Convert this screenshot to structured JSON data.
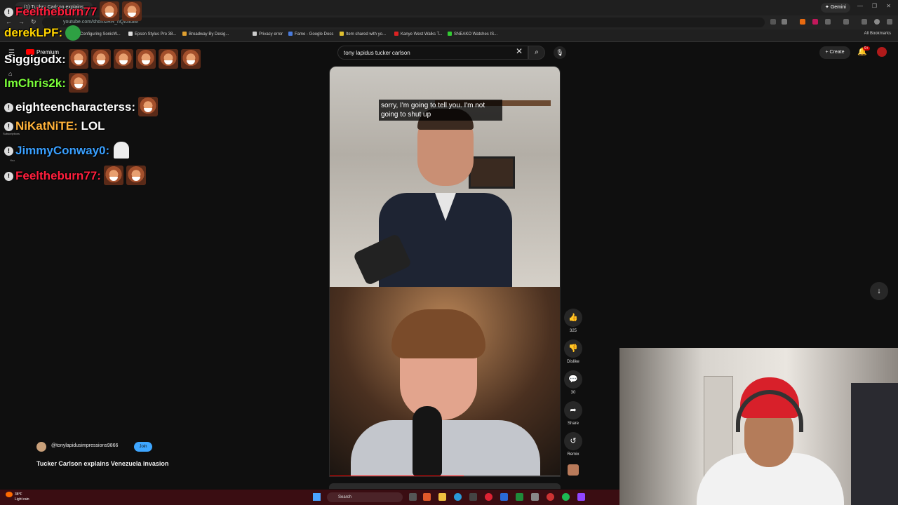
{
  "browser": {
    "tab_title": "(1) Tucker Carlson explains...",
    "gemini_label": "Gemini",
    "url": "youtube.com/shorts/RR_nQtGtdlM",
    "bookmarks": [
      "Configuring SonicW...",
      "Epson Stylus Pro 38...",
      "Broadway By Desig...",
      "Privacy error",
      "Fame - Google Docs",
      "Item shared with yo...",
      "Kanye West Walks T...",
      "SNEAKO Watches IS..."
    ],
    "all_bookmarks": "All Bookmarks"
  },
  "youtube": {
    "premium_label": "Premium",
    "search_value": "tony lapidus tucker carlson",
    "create_label": "Create",
    "notif_badge": "9+",
    "subscriptions_label": "Subscriptions",
    "you_label": "You"
  },
  "chat": [
    {
      "user": "Feeltheburn77",
      "color": "#ff1f3d",
      "msg": "",
      "emotes": 2
    },
    {
      "user": "derekLPF",
      "color": "#ffd400",
      "msg": "",
      "emotes": 0
    },
    {
      "user": "Siggigodx",
      "color": "#ffffff",
      "msg": "",
      "emotes": 6
    },
    {
      "user": "ImChris2k",
      "color": "#7cff3a",
      "msg": "",
      "emotes": 1
    },
    {
      "user": "eighteencharacterss",
      "color": "#ffffff",
      "msg": "",
      "emotes": 1
    },
    {
      "user": "NiKatNiTE",
      "color": "#ffb23a",
      "msg": "LOL",
      "emotes": 0
    },
    {
      "user": "JimmyConway0",
      "color": "#3aa0ff",
      "msg": "",
      "emotes": 0
    },
    {
      "user": "Feeltheburn77",
      "color": "#ff1f3d",
      "msg": "",
      "emotes": 2
    }
  ],
  "video": {
    "caption": "sorry, I'm going to tell you. I'm not going to shut up",
    "progress": 0.58,
    "channel": "@tonylapidusimpressions9866",
    "join_label": "Join",
    "title": "Tucker Carlson explains Venezuela invasion"
  },
  "actions": {
    "like_count": "325",
    "dislike_label": "Dislike",
    "comment_count": "30",
    "share_label": "Share",
    "remix_label": "Remix"
  },
  "taskbar": {
    "temp": "38°F",
    "weather": "Light rain",
    "search_placeholder": "Search"
  },
  "colors": {
    "accent_red": "#ff0000",
    "join_blue": "#3ea6ff",
    "taskbar": "#3a0d12"
  }
}
